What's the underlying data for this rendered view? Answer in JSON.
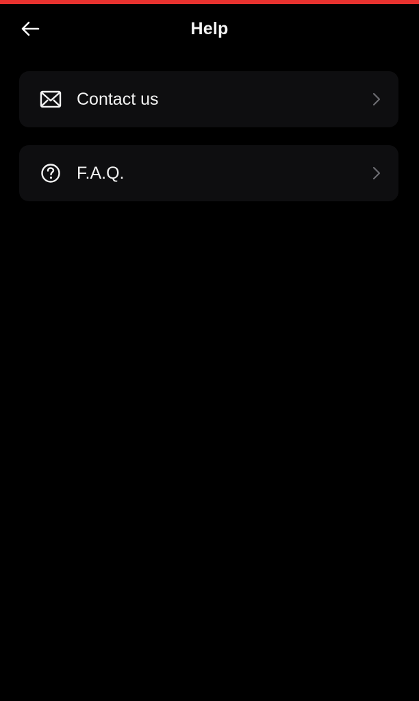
{
  "header": {
    "title": "Help",
    "back_icon": "arrow-left-icon"
  },
  "menu": {
    "items": [
      {
        "label": "Contact us",
        "icon": "mail-icon",
        "trailing_icon": "chevron-right-icon"
      },
      {
        "label": "F.A.Q.",
        "icon": "question-circle-icon",
        "trailing_icon": "chevron-right-icon"
      }
    ]
  },
  "colors": {
    "background": "#000000",
    "card": "#0e0e10",
    "accent_bar": "#e8322f",
    "text": "#f2f2f2",
    "chevron": "#6b6b70"
  }
}
